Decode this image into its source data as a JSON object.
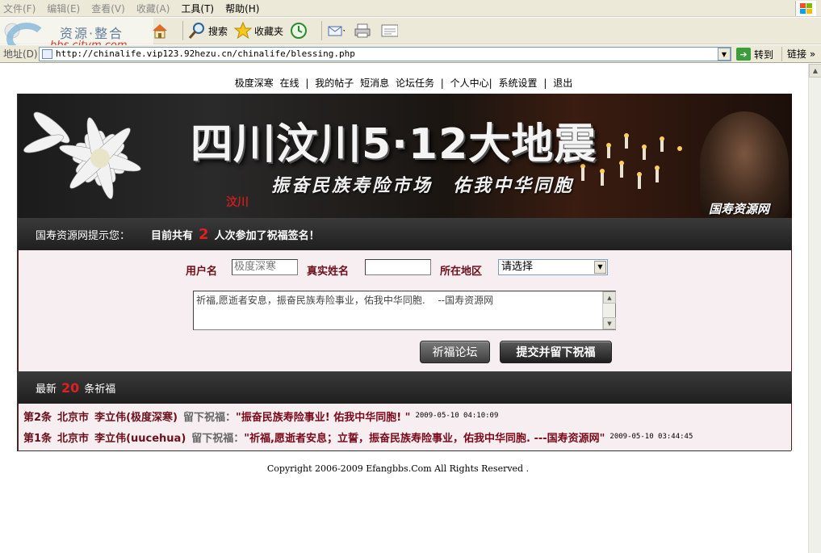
{
  "browser": {
    "menu": [
      "文件(F)",
      "编辑(E)",
      "查看(V)",
      "收藏(A)",
      "工具(T)",
      "帮助(H)"
    ],
    "toolbar": {
      "search": "搜索",
      "favorites": "收藏夹"
    },
    "address_label": "地址(D)",
    "url": "http://chinalife.vip123.92hezu.cn/chinalife/blessing.php",
    "go_label": "转到",
    "links_label": "链接",
    "links_chevron": "»"
  },
  "watermark": {
    "text": "资源·整合",
    "url": "bbs.citvm.com"
  },
  "topnav": [
    "极度深寒",
    "在线",
    "|",
    "我的帖子",
    "短消息",
    "论坛任务",
    "|",
    "个人中心|",
    "系统设置",
    "|",
    "退出"
  ],
  "banner": {
    "title": "四川汶川5·12大地震",
    "subtitle": "振奋民族寿险市场　佑我中华同胞",
    "wenchuan": "汶川",
    "site": "国寿资源网"
  },
  "notice": {
    "hint": "国寿资源网提示您：",
    "prefix": "目前共有",
    "count": "2",
    "suffix": "人次参加了祝福签名！"
  },
  "form": {
    "username_label": "用户名",
    "username_value": "极度深寒",
    "realname_label": "真实姓名",
    "realname_value": "",
    "region_label": "所在地区",
    "region_value": "请选择",
    "message": "祈福,愿逝者安息，振奋民族寿险事业，佑我中华同胞.　 --国寿资源网",
    "forum_button": "祈福论坛",
    "submit_button": "提交并留下祝福"
  },
  "list": {
    "prefix": "最新",
    "count": "20",
    "suffix": "条祈福",
    "rows": [
      {
        "index": "第2条",
        "city": "北京市",
        "user": "李立伟(极度深寒)",
        "verb": "留下祝福：",
        "message": "\"振奋民族寿险事业! 佑我中华同胞! \"",
        "time": "2009-05-10 04:10:09"
      },
      {
        "index": "第1条",
        "city": "北京市",
        "user": "李立伟(uucehua)",
        "verb": "留下祝福：",
        "message": "\"祈福,愿逝者安息；立誓，振奋民族寿险事业，佑我中华同胞. ---国寿资源网\"",
        "time": "2009-05-10 03:44:45"
      }
    ]
  },
  "footer": "Copyright 2006-2009 Efangbbs.Com All Rights Reserved ."
}
